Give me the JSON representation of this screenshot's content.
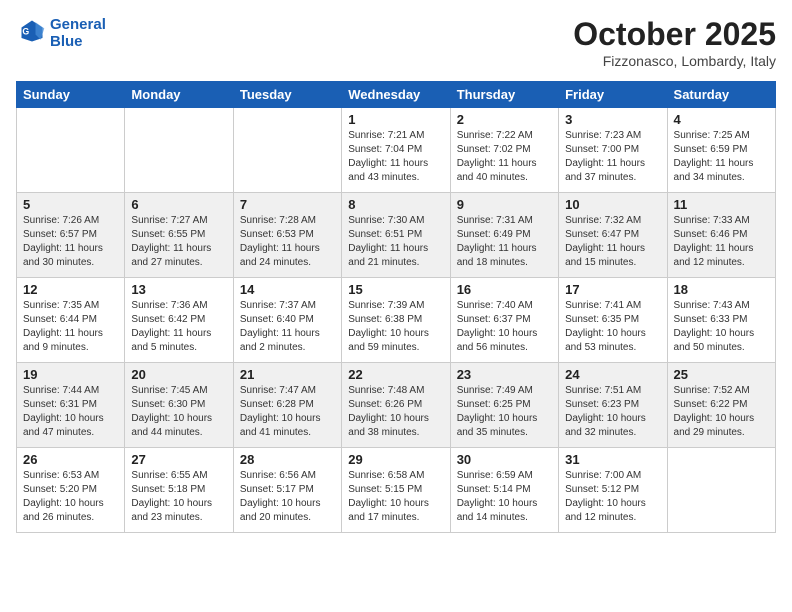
{
  "header": {
    "logo_line1": "General",
    "logo_line2": "Blue",
    "month": "October 2025",
    "location": "Fizzonasco, Lombardy, Italy"
  },
  "days_of_week": [
    "Sunday",
    "Monday",
    "Tuesday",
    "Wednesday",
    "Thursday",
    "Friday",
    "Saturday"
  ],
  "weeks": [
    {
      "days": [
        {
          "num": "",
          "info": ""
        },
        {
          "num": "",
          "info": ""
        },
        {
          "num": "",
          "info": ""
        },
        {
          "num": "1",
          "info": "Sunrise: 7:21 AM\nSunset: 7:04 PM\nDaylight: 11 hours\nand 43 minutes."
        },
        {
          "num": "2",
          "info": "Sunrise: 7:22 AM\nSunset: 7:02 PM\nDaylight: 11 hours\nand 40 minutes."
        },
        {
          "num": "3",
          "info": "Sunrise: 7:23 AM\nSunset: 7:00 PM\nDaylight: 11 hours\nand 37 minutes."
        },
        {
          "num": "4",
          "info": "Sunrise: 7:25 AM\nSunset: 6:59 PM\nDaylight: 11 hours\nand 34 minutes."
        }
      ]
    },
    {
      "days": [
        {
          "num": "5",
          "info": "Sunrise: 7:26 AM\nSunset: 6:57 PM\nDaylight: 11 hours\nand 30 minutes."
        },
        {
          "num": "6",
          "info": "Sunrise: 7:27 AM\nSunset: 6:55 PM\nDaylight: 11 hours\nand 27 minutes."
        },
        {
          "num": "7",
          "info": "Sunrise: 7:28 AM\nSunset: 6:53 PM\nDaylight: 11 hours\nand 24 minutes."
        },
        {
          "num": "8",
          "info": "Sunrise: 7:30 AM\nSunset: 6:51 PM\nDaylight: 11 hours\nand 21 minutes."
        },
        {
          "num": "9",
          "info": "Sunrise: 7:31 AM\nSunset: 6:49 PM\nDaylight: 11 hours\nand 18 minutes."
        },
        {
          "num": "10",
          "info": "Sunrise: 7:32 AM\nSunset: 6:47 PM\nDaylight: 11 hours\nand 15 minutes."
        },
        {
          "num": "11",
          "info": "Sunrise: 7:33 AM\nSunset: 6:46 PM\nDaylight: 11 hours\nand 12 minutes."
        }
      ]
    },
    {
      "days": [
        {
          "num": "12",
          "info": "Sunrise: 7:35 AM\nSunset: 6:44 PM\nDaylight: 11 hours\nand 9 minutes."
        },
        {
          "num": "13",
          "info": "Sunrise: 7:36 AM\nSunset: 6:42 PM\nDaylight: 11 hours\nand 5 minutes."
        },
        {
          "num": "14",
          "info": "Sunrise: 7:37 AM\nSunset: 6:40 PM\nDaylight: 11 hours\nand 2 minutes."
        },
        {
          "num": "15",
          "info": "Sunrise: 7:39 AM\nSunset: 6:38 PM\nDaylight: 10 hours\nand 59 minutes."
        },
        {
          "num": "16",
          "info": "Sunrise: 7:40 AM\nSunset: 6:37 PM\nDaylight: 10 hours\nand 56 minutes."
        },
        {
          "num": "17",
          "info": "Sunrise: 7:41 AM\nSunset: 6:35 PM\nDaylight: 10 hours\nand 53 minutes."
        },
        {
          "num": "18",
          "info": "Sunrise: 7:43 AM\nSunset: 6:33 PM\nDaylight: 10 hours\nand 50 minutes."
        }
      ]
    },
    {
      "days": [
        {
          "num": "19",
          "info": "Sunrise: 7:44 AM\nSunset: 6:31 PM\nDaylight: 10 hours\nand 47 minutes."
        },
        {
          "num": "20",
          "info": "Sunrise: 7:45 AM\nSunset: 6:30 PM\nDaylight: 10 hours\nand 44 minutes."
        },
        {
          "num": "21",
          "info": "Sunrise: 7:47 AM\nSunset: 6:28 PM\nDaylight: 10 hours\nand 41 minutes."
        },
        {
          "num": "22",
          "info": "Sunrise: 7:48 AM\nSunset: 6:26 PM\nDaylight: 10 hours\nand 38 minutes."
        },
        {
          "num": "23",
          "info": "Sunrise: 7:49 AM\nSunset: 6:25 PM\nDaylight: 10 hours\nand 35 minutes."
        },
        {
          "num": "24",
          "info": "Sunrise: 7:51 AM\nSunset: 6:23 PM\nDaylight: 10 hours\nand 32 minutes."
        },
        {
          "num": "25",
          "info": "Sunrise: 7:52 AM\nSunset: 6:22 PM\nDaylight: 10 hours\nand 29 minutes."
        }
      ]
    },
    {
      "days": [
        {
          "num": "26",
          "info": "Sunrise: 6:53 AM\nSunset: 5:20 PM\nDaylight: 10 hours\nand 26 minutes."
        },
        {
          "num": "27",
          "info": "Sunrise: 6:55 AM\nSunset: 5:18 PM\nDaylight: 10 hours\nand 23 minutes."
        },
        {
          "num": "28",
          "info": "Sunrise: 6:56 AM\nSunset: 5:17 PM\nDaylight: 10 hours\nand 20 minutes."
        },
        {
          "num": "29",
          "info": "Sunrise: 6:58 AM\nSunset: 5:15 PM\nDaylight: 10 hours\nand 17 minutes."
        },
        {
          "num": "30",
          "info": "Sunrise: 6:59 AM\nSunset: 5:14 PM\nDaylight: 10 hours\nand 14 minutes."
        },
        {
          "num": "31",
          "info": "Sunrise: 7:00 AM\nSunset: 5:12 PM\nDaylight: 10 hours\nand 12 minutes."
        },
        {
          "num": "",
          "info": ""
        }
      ]
    }
  ]
}
